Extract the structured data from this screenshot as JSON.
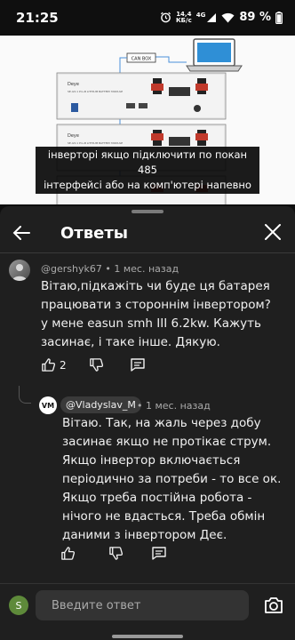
{
  "status": {
    "time": "21:25",
    "speed_value": "14,4",
    "speed_unit": "КБ/с",
    "network": "4G",
    "battery": "89 %"
  },
  "video": {
    "can_box_label": "CAN BOX",
    "brand": "Deye",
    "module_label": "SE-G5.1 Pro-B  LITHIUM BATTERY MODULE",
    "subtitle_line1": "інверторі якщо підключити по покан 485",
    "subtitle_line2": "інтерфейсі або на комп'ютері напевно"
  },
  "sheet": {
    "title": "Ответы",
    "icons": {
      "back": "back-arrow-icon",
      "close": "close-icon"
    }
  },
  "comment": {
    "author": "@gershyk67",
    "time": " • 1 мес. назад",
    "lines": [
      "Вітаю,підкажіть чи буде ця батарея",
      "працювати з стороннім інвертором?",
      "у мене easun smh III 6.2kw. Кажуть",
      "засинає, і таке інше. Дякую."
    ],
    "likes": "2"
  },
  "reply": {
    "avatar_text": "VM",
    "author": "@Vladyslav_M",
    "time": " • 1 мес. назад",
    "lines": [
      "Вітаю. Так, на жаль через добу",
      "засинає якщо не протікає струм.",
      "Якщо інвертор включається",
      "періодично за потреби - то все ок.",
      "Якщо треба постійна робота -",
      "нічого не вдасться. Треба обмін",
      "даними з інвертором Деє."
    ]
  },
  "composer": {
    "avatar_letter": "S",
    "placeholder": "Введите ответ",
    "icon": "camera-icon"
  },
  "colors": {
    "background": "#0f0f0f",
    "sheet": "#1f1f1f",
    "text": "#f1f1f1",
    "meta": "#aaaaaa",
    "battery_terminal_red": "#c0392b"
  }
}
